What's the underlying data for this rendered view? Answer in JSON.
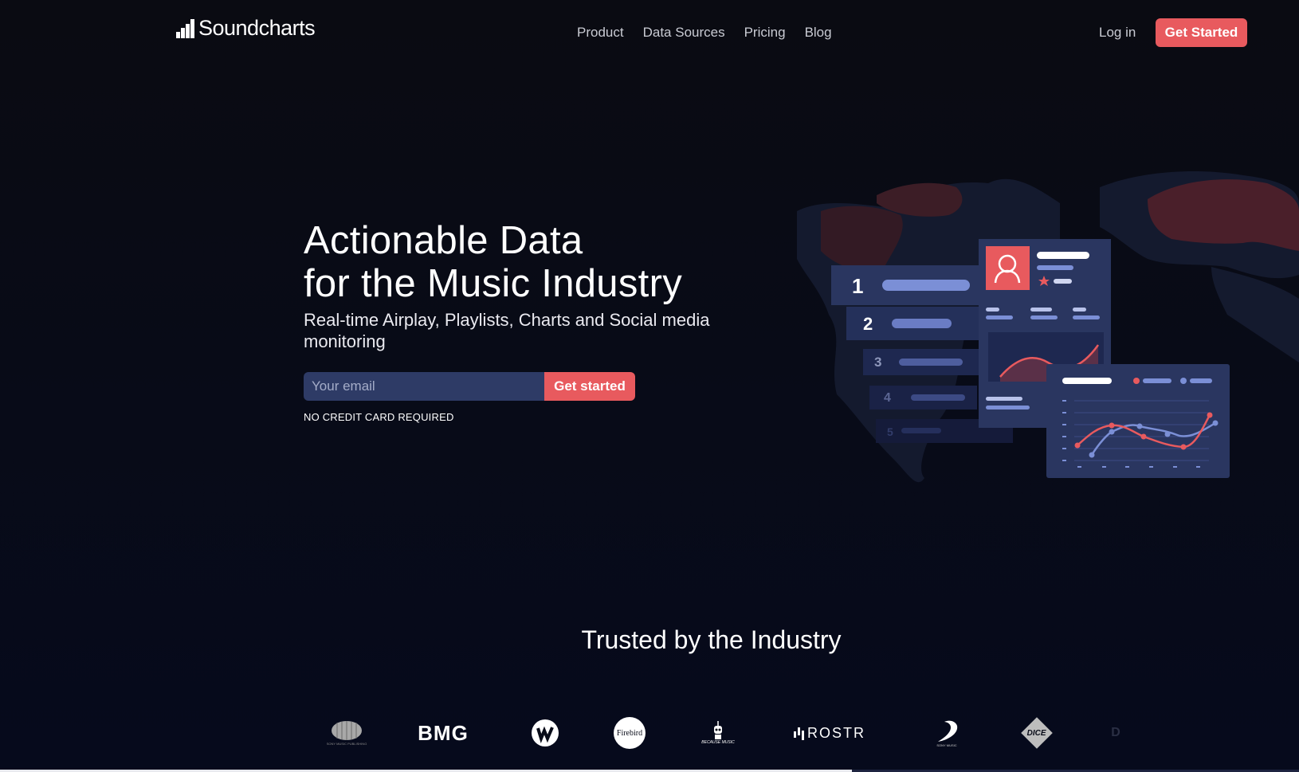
{
  "nav": {
    "brand": "Soundcharts",
    "links": [
      "Product",
      "Data Sources",
      "Pricing",
      "Blog"
    ],
    "login": "Log in",
    "cta": "Get Started"
  },
  "hero": {
    "title_line1": "Actionable Data",
    "title_line2": "for the Music Industry",
    "subtitle": "Real-time Airplay, Playlists, Charts and Social media monitoring",
    "email_placeholder": "Your email",
    "email_button": "Get started",
    "note": "NO CREDIT CARD REQUIRED"
  },
  "illustration": {
    "ranks": [
      "1",
      "2",
      "3",
      "4",
      "5"
    ]
  },
  "trusted": {
    "heading": "Trusted by the Industry",
    "logos": [
      "SONY MUSIC PUBLISHING",
      "BMG",
      "Warner",
      "Firebird",
      "BECAUSE MUSIC",
      "ROSTR",
      "SONY MUSIC",
      "DICE",
      "D"
    ]
  },
  "scroll_progress": 0.656,
  "colors": {
    "accent": "#e85a5e",
    "panel": "#2a3660",
    "line_blue": "#7b8fd6"
  }
}
